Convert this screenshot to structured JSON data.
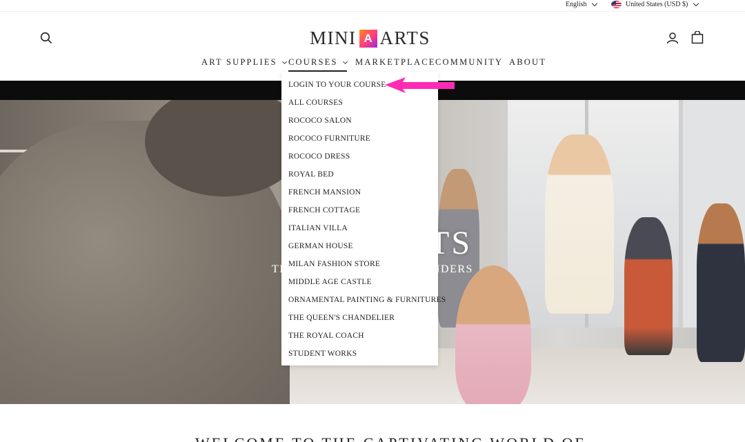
{
  "utility": {
    "language": "English",
    "country": "United States (USD $)"
  },
  "header": {
    "logo_left": "MINI",
    "logo_mark": "A",
    "logo_right": "ARTS"
  },
  "nav": {
    "items": [
      {
        "label": "ART SUPPLIES",
        "has_dropdown": true
      },
      {
        "label": "COURSES",
        "has_dropdown": true
      },
      {
        "label": "MARKETPLACE",
        "has_dropdown": false
      },
      {
        "label": "COMMUNITY",
        "has_dropdown": false
      },
      {
        "label": "ABOUT",
        "has_dropdown": false
      }
    ]
  },
  "courses_menu": [
    "LOGIN TO YOUR COURSE",
    "ALL COURSES",
    "ROCOCO SALON",
    "ROCOCO FURNITURE",
    "ROCOCO DRESS",
    "ROYAL BED",
    "FRENCH MANSION",
    "FRENCH COTTAGE",
    "ITALIAN VILLA",
    "GERMAN HOUSE",
    "MILAN FASHION STORE",
    "MIDDLE AGE CASTLE",
    "ORNAMENTAL PAINTING & FURNITURES",
    "THE QUEEN'S CHANDELIER",
    "THE ROYAL COACH",
    "STUDENT WORKS"
  ],
  "hero": {
    "title_visible": "TS",
    "subtitle_left_visible": "TH",
    "subtitle_right_visible": "NDERS"
  },
  "section": {
    "heading_partial": "WELCOME TO THE CAPTIVATING WORLD OF"
  },
  "colors": {
    "annotation_arrow": "#ff2bb5",
    "announce_bar": "#0c0c0c"
  },
  "icons": [
    "search-icon",
    "account-icon",
    "cart-icon",
    "flag-us-icon",
    "chevron-down-icon"
  ]
}
